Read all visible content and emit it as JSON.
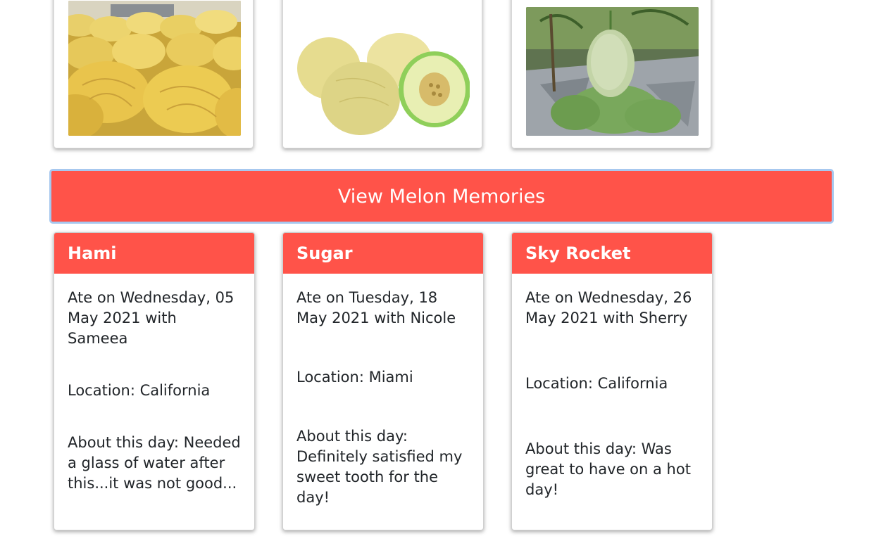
{
  "photos": [
    {
      "icon": "melon-pile-photo"
    },
    {
      "icon": "cut-melon-photo"
    },
    {
      "icon": "melon-on-vine-photo"
    }
  ],
  "button": {
    "label": "View Melon Memories"
  },
  "colors": {
    "accent": "#ff5349",
    "button_border": "#a7c8ef"
  },
  "memories": [
    {
      "name": "Hami",
      "ate": "Ate on Wednesday, 05 May 2021 with Sameea",
      "location": "Location: California",
      "about": "About this day: Needed a glass of water after this...it was not good..."
    },
    {
      "name": "Sugar",
      "ate": "Ate on Tuesday, 18 May 2021 with Nicole",
      "location": "Location: Miami",
      "about": "About this day: Definitely satisfied my sweet tooth for the day!"
    },
    {
      "name": "Sky Rocket",
      "ate": "Ate on Wednesday, 26 May 2021 with Sherry",
      "location": "Location: California",
      "about": "About this day: Was great to have on a hot day!"
    }
  ]
}
